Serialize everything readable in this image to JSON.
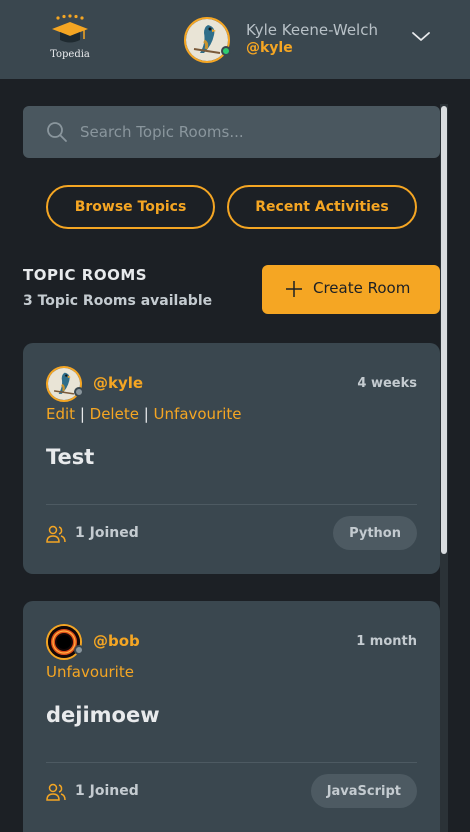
{
  "header": {
    "logo_text": "Topedia",
    "user_name": "Kyle Keene-Welch",
    "user_handle": "@kyle"
  },
  "search": {
    "placeholder": "Search Topic Rooms..."
  },
  "nav": {
    "browse_label": "Browse Topics",
    "recent_label": "Recent Activities"
  },
  "rooms": {
    "title": "TOPIC ROOMS",
    "count_text": "3 Topic Rooms available",
    "create_label": "Create Room"
  },
  "cards": [
    {
      "handle": "@kyle",
      "time": "4 weeks",
      "actions": [
        "Edit",
        "Delete",
        "Unfavourite"
      ],
      "title": "Test",
      "joined": "1 Joined",
      "tag": "Python"
    },
    {
      "handle": "@bob",
      "time": "1 month",
      "actions": [
        "Unfavourite"
      ],
      "title": "dejimoew",
      "joined": "1 Joined",
      "tag": "JavaScript"
    }
  ],
  "colors": {
    "accent": "#f5a623",
    "online": "#2ecc71",
    "offline": "#8a969d"
  }
}
